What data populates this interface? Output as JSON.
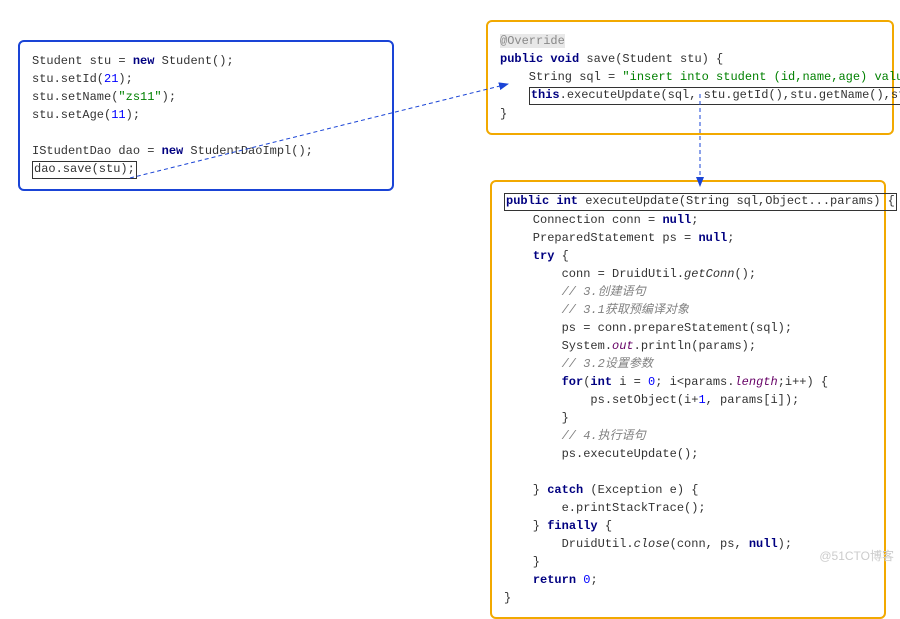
{
  "box1": {
    "l1_a": "Student stu = ",
    "l1_kw": "new",
    "l1_b": " Student();",
    "l2_a": "stu.setId(",
    "l2_n": "21",
    "l2_b": ");",
    "l3_a": "stu.setName(",
    "l3_s": "\"zs11\"",
    "l3_b": ");",
    "l4_a": "stu.setAge(",
    "l4_n": "11",
    "l4_b": ");",
    "l6_a": "IStudentDao dao = ",
    "l6_kw": "new",
    "l6_b": " StudentDaoImpl();",
    "l7_sel": "dao.save(stu);"
  },
  "box2": {
    "a1": "@Override",
    "l1_kw": "public void",
    "l1_b": " save(Student stu) {",
    "l2_a": "    String sql = ",
    "l2_s": "\"insert into student (id,name,age) values(?,?,?)\"",
    "l2_b": ";",
    "l3_pad": "    ",
    "l3_kw": "this",
    "l3_b": ".executeUpdate(sql, stu.getId(),stu.getName(),stu.getAge());",
    "l4": "}"
  },
  "box3": {
    "sig_kw1": "public int",
    "sig_b": " executeUpdate(String sql,Object...params) {",
    "l2_a": "    Connection conn = ",
    "l2_kw": "null",
    "l2_b": ";",
    "l3_a": "    PreparedStatement ps = ",
    "l3_kw": "null",
    "l3_b": ";",
    "l4_kw": "try",
    "l4_b": " {",
    "l5_a": "        conn = DruidUtil.",
    "l5_st": "getConn",
    "l5_b": "();",
    "c1": "        // 3.创建语句",
    "c2": "        // 3.1获取预编译对象",
    "l8": "        ps = conn.prepareStatement(sql);",
    "l9_a": "        System.",
    "l9_f": "out",
    "l9_b": ".println(params);",
    "c3": "        // 3.2设置参数",
    "l11_kw1": "for",
    "l11_a": "(",
    "l11_kw2": "int",
    "l11_b": " i = ",
    "l11_n": "0",
    "l11_c": "; i<params.",
    "l11_f": "length",
    "l11_d": ";i++) {",
    "l12_a": "            ps.setObject(i+",
    "l12_n": "1",
    "l12_b": ", params[i]);",
    "l13": "        }",
    "c4": "        // 4.执行语句",
    "l15": "        ps.executeUpdate();",
    "blank": "",
    "l17_a": "    } ",
    "l17_kw": "catch",
    "l17_b": " (Exception e) {",
    "l18": "        e.printStackTrace();",
    "l19_a": "    } ",
    "l19_kw": "finally",
    "l19_b": " {",
    "l20_a": "        DruidUtil.",
    "l20_st": "close",
    "l20_b": "(conn, ps, ",
    "l20_kw": "null",
    "l20_c": ");",
    "l21": "    }",
    "l22_kw": "return ",
    "l22_n": "0",
    "l22_b": ";",
    "l23": "}"
  },
  "watermark": "@51CTO博客"
}
